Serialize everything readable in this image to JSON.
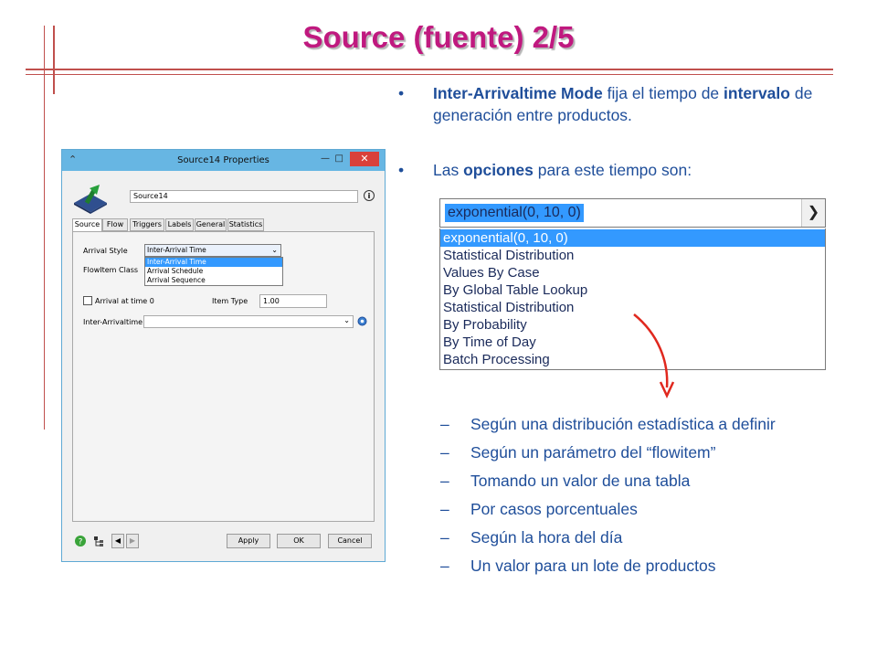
{
  "slide": {
    "title": "Source (fuente) 2/5",
    "bullets": [
      {
        "dot": "•",
        "bold1": "Inter-Arrivaltime Mode",
        "text1": " fija el tiempo de ",
        "bold2": "intervalo",
        "text2": " de generación entre productos."
      },
      {
        "dot": "•",
        "text1": "Las ",
        "bold1": "opciones",
        "text2": " para este tiempo son:"
      }
    ],
    "sub_items": [
      "Según una distribución estadística a definir",
      "Según un parámetro del “flowitem”",
      "Tomando un valor de una tabla",
      "Por casos porcentuales",
      "Según la hora del día",
      "Un valor para un lote de productos"
    ],
    "dash": "–"
  },
  "big_dropdown": {
    "selected": "exponential(0, 10, 0)",
    "options": [
      "exponential(0, 10, 0)",
      "Statistical Distribution",
      "Values By Case",
      "By Global Table Lookup",
      "Statistical Distribution",
      "By Probability",
      "By Time of Day",
      "Batch Processing"
    ]
  },
  "window": {
    "title": "Source14  Properties",
    "name_value": "Source14",
    "tabs": [
      "Source",
      "Flow",
      "Triggers",
      "Labels",
      "General",
      "Statistics"
    ],
    "arrival_style_label": "Arrival Style",
    "arrival_style_value": "Inter-Arrival Time",
    "arrival_style_options": [
      "Inter-Arrival Time",
      "Arrival Schedule",
      "Arrival Sequence"
    ],
    "flowitem_class_label": "FlowItem Class",
    "arrival_at_time0_label": "Arrival at time 0",
    "item_type_label": "Item Type",
    "item_type_value": "1.00",
    "inter_arrivaltime_label": "Inter-Arrivaltime",
    "apply_label": "Apply",
    "ok_label": "OK",
    "cancel_label": "Cancel"
  },
  "colors": {
    "title": "#c0197f",
    "body_text": "#1f4e9a",
    "deco_lines": "#c0504d",
    "window_titlebar": "#67b6e3",
    "selection": "#3399ff"
  }
}
